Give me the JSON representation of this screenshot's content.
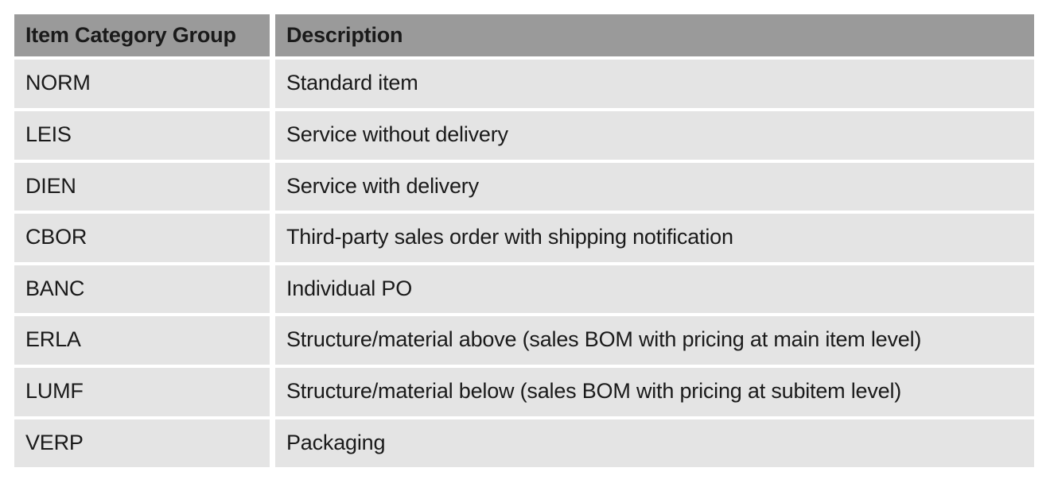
{
  "table": {
    "columns": [
      {
        "key": "code",
        "header": "Item Category Group"
      },
      {
        "key": "description",
        "header": "Description"
      }
    ],
    "rows": [
      {
        "code": "NORM",
        "description": "Standard item"
      },
      {
        "code": "LEIS",
        "description": "Service without delivery"
      },
      {
        "code": "DIEN",
        "description": "Service with delivery"
      },
      {
        "code": "CBOR",
        "description": "Third-party sales order with shipping notification"
      },
      {
        "code": "BANC",
        "description": "Individual PO"
      },
      {
        "code": "ERLA",
        "description": "Structure/material above (sales BOM with pricing at main item level)"
      },
      {
        "code": "LUMF",
        "description": "Structure/material below (sales BOM with pricing at subitem level)"
      },
      {
        "code": "VERP",
        "description": "Packaging"
      }
    ]
  },
  "colors": {
    "header_background": "#9a9a9a",
    "row_background": "#e4e4e4",
    "page_background": "#ffffff",
    "text": "#1a1a1a"
  }
}
